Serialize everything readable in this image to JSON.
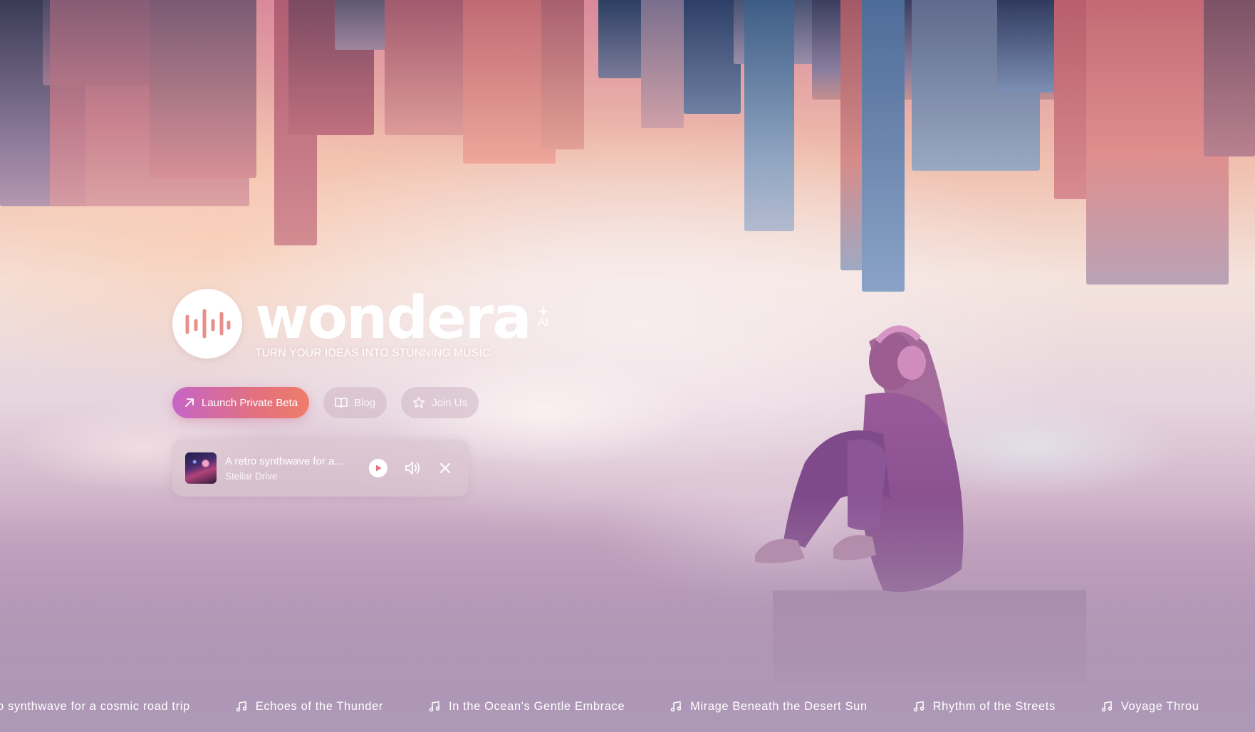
{
  "brand": {
    "name": "wondera",
    "ai_label": "AI",
    "tagline": "TURN YOUR IDEAS INTO STUNNING MUSIC",
    "logo_icon": "waveform-icon"
  },
  "actions": {
    "launch_label": "Launch Private Beta",
    "launch_icon": "arrow-up-right-icon",
    "blog_label": "Blog",
    "blog_icon": "book-open-icon",
    "join_label": "Join Us",
    "join_icon": "star-icon"
  },
  "player": {
    "title": "A retro synthwave for a...",
    "artist": "Stellar Drive",
    "play_icon": "play-icon",
    "volume_icon": "volume-icon",
    "close_icon": "close-icon"
  },
  "ticker": [
    "o synthwave for a cosmic road trip",
    "Echoes of the Thunder",
    "In the Ocean's Gentle Embrace",
    "Mirage Beneath the Desert Sun",
    "Rhythm of the Streets",
    "Voyage Throu"
  ],
  "colors": {
    "accent_start": "#c565c8",
    "accent_end": "#ef7c6a",
    "text": "#ffffff"
  }
}
